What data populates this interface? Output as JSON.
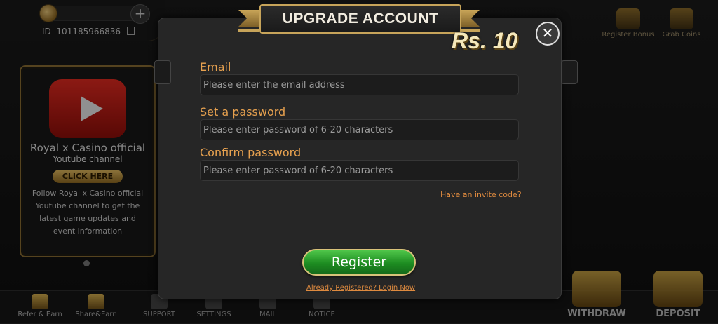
{
  "user": {
    "id_label": "ID",
    "id_value": "101185966836"
  },
  "top_right": [
    {
      "label": "Register Bonus",
      "icon": "register-bonus-icon"
    },
    {
      "label": "Grab Coins",
      "icon": "grab-coins-icon"
    }
  ],
  "promo": {
    "title": "Royal x Casino official",
    "subtitle": "Youtube channel",
    "button_label": "CLICK HERE",
    "description": "Follow Royal x Casino official Youtube channel to get the latest game updates and event information"
  },
  "bottom_nav": [
    {
      "label": "Refer & Earn",
      "icon": "refer-earn-icon"
    },
    {
      "label": "Share&Earn",
      "icon": "share-earn-icon"
    },
    {
      "label": "SUPPORT",
      "icon": "support-icon"
    },
    {
      "label": "SETTINGS",
      "icon": "settings-icon"
    },
    {
      "label": "MAIL",
      "icon": "mail-icon"
    },
    {
      "label": "NOTICE",
      "icon": "notice-icon"
    }
  ],
  "actions": {
    "withdraw": "WITHDRAW",
    "deposit": "DEPOSIT"
  },
  "modal": {
    "title": "UPGRADE ACCOUNT",
    "reward": "Rs. 10",
    "close_symbol": "✕",
    "email": {
      "label": "Email",
      "placeholder": "Please enter the email address",
      "value": ""
    },
    "password": {
      "label": "Set a password",
      "placeholder": "Please enter password of 6-20 characters",
      "value": ""
    },
    "confirm": {
      "label": "Confirm password",
      "placeholder": "Please enter password of 6-20 characters",
      "value": ""
    },
    "invite_link": "Have an invite code?",
    "register_button": "Register",
    "login_link": "Already Registered? Login Now"
  },
  "colors": {
    "accent_orange": "#e7a14f",
    "link_orange": "#de8a3f",
    "gold": "#c7a45a",
    "register_green": "#1d8c21"
  }
}
